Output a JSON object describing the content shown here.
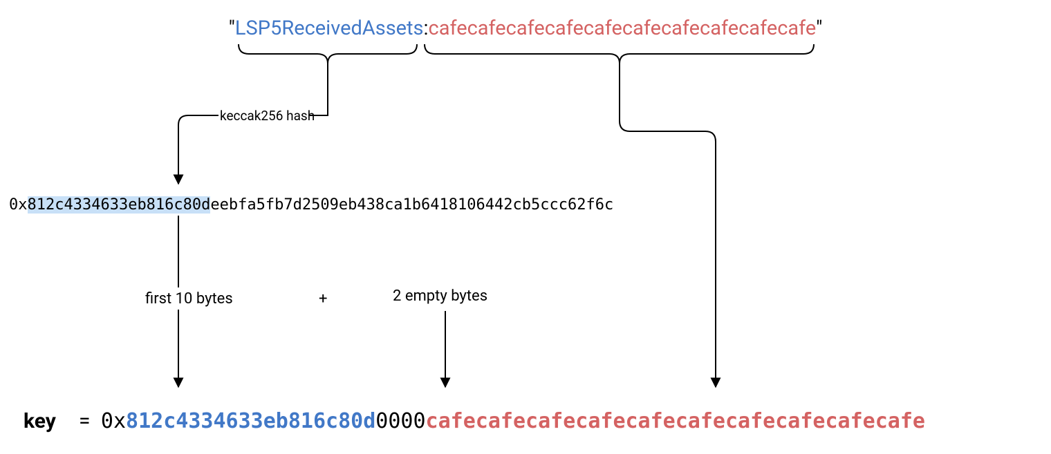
{
  "top": {
    "quote_open": "\"",
    "key_name": "LSP5ReceivedAssets",
    "colon": ":",
    "address": "cafecafecafecafecafecafecafecafecafecafe",
    "quote_close": "\""
  },
  "labels": {
    "keccak": "keccak256 hash",
    "first10": "first 10 bytes",
    "plus": "+",
    "two_empty": "2 empty bytes",
    "key": "key"
  },
  "hash": {
    "prefix": "0x",
    "first10": "812c4334633eb816c80d",
    "rest": "eebfa5fb7d2509eb438ca1b6418106442cb5ccc62f6c"
  },
  "final": {
    "eq": "= ",
    "prefix": "0x",
    "first10": "812c4334633eb816c80d",
    "zeros": "0000",
    "address": "cafecafecafecafecafecafecafecafecafecafe"
  }
}
